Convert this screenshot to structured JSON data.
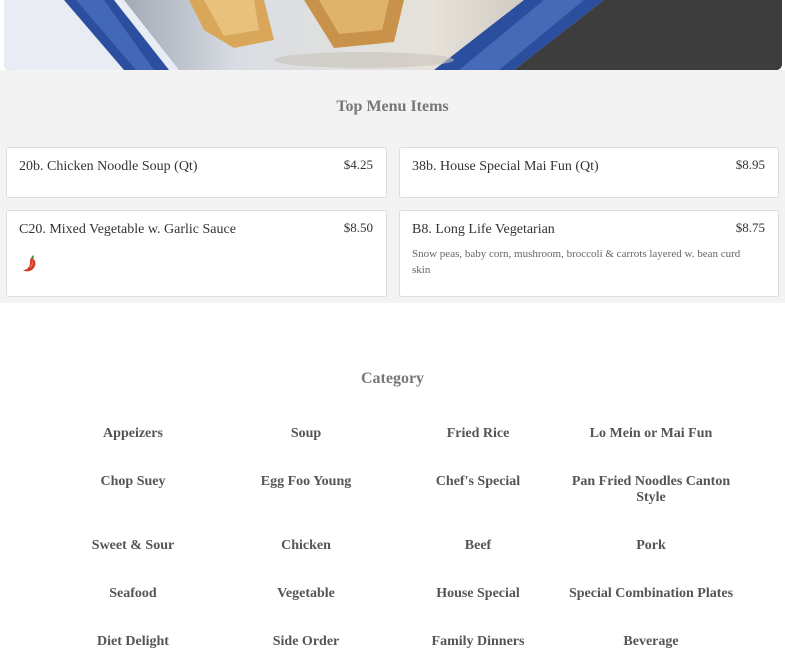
{
  "hero": {
    "image": "spring-rolls-on-blue-plate"
  },
  "top_menu": {
    "title": "Top Menu Items",
    "items": [
      {
        "name": "20b. Chicken Noodle Soup (Qt)",
        "price": "$4.25",
        "description": ""
      },
      {
        "name": "38b. House Special Mai Fun (Qt)",
        "price": "$8.95",
        "description": ""
      },
      {
        "name": "C20. Mixed Vegetable w. Garlic Sauce",
        "price": "$8.50",
        "description": "",
        "icon": "chili-pepper-icon"
      },
      {
        "name": "B8. Long Life Vegetarian",
        "price": "$8.75",
        "description": "Snow peas, baby corn, mushroom, broccoli & carrots layered w. bean curd skin"
      }
    ]
  },
  "category": {
    "title": "Category",
    "items": [
      "Appeizers",
      "Soup",
      "Fried Rice",
      "Lo Mein or Mai Fun",
      "Chop Suey",
      "Egg Foo Young",
      "Chef's Special",
      "Pan Fried Noodles Canton Style",
      "Sweet & Sour",
      "Chicken",
      "Beef",
      "Pork",
      "Seafood",
      "Vegetable",
      "House Special",
      "Special Combination Plates",
      "Diet Delight",
      "Side Order",
      "Family Dinners",
      "Beverage"
    ]
  },
  "colors": {
    "chili": "#d23a2a",
    "plate_blue": "#2b4f9e",
    "section_bg": "#f3f3f3"
  }
}
